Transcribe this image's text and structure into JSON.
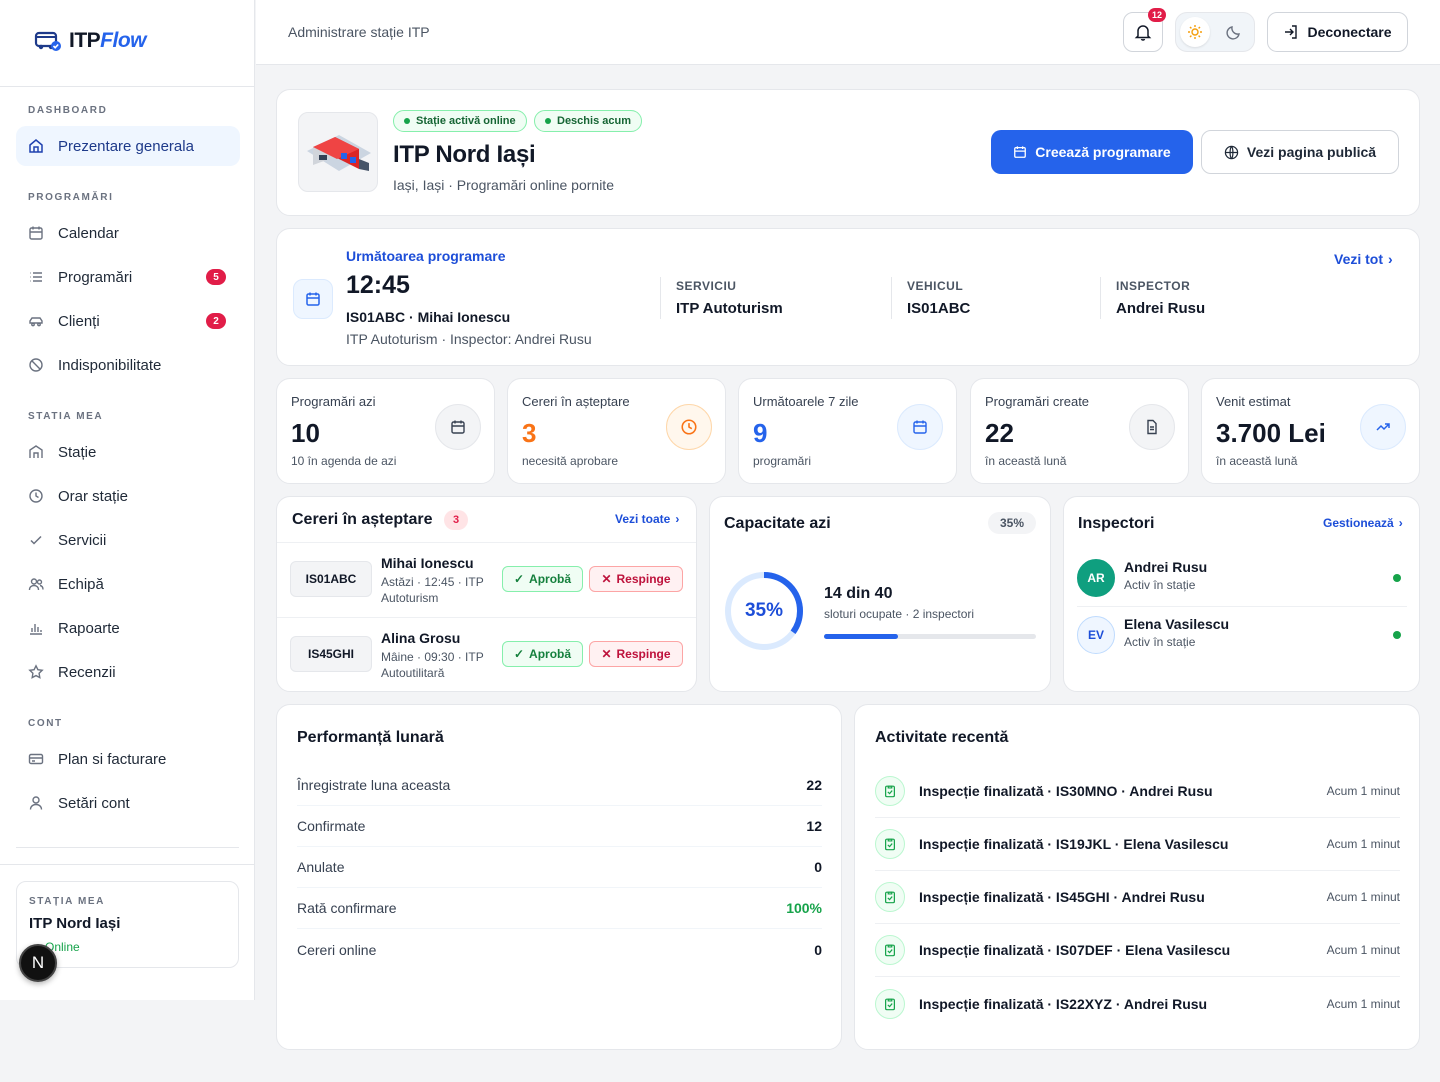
{
  "brand": {
    "name_part1": "ITP",
    "name_part2": "Flow"
  },
  "sidebar": {
    "sections": {
      "dashboard": "DASHBOARD",
      "programari": "PROGRAMĂRI",
      "statia": "STATIA MEA",
      "cont": "CONT"
    },
    "items": {
      "overview": "Prezentare generala",
      "calendar": "Calendar",
      "programari": "Programări",
      "programari_badge": "5",
      "clienti": "Clienți",
      "clienti_badge": "2",
      "indisponibilitate": "Indisponibilitate",
      "statie": "Stație",
      "orar": "Orar stație",
      "servicii": "Servicii",
      "echipa": "Echipă",
      "rapoarte": "Rapoarte",
      "recenzii": "Recenzii",
      "plan": "Plan si facturare",
      "setari": "Setări cont"
    },
    "my_station": {
      "label": "STAȚIA MEA",
      "name": "ITP Nord Iași",
      "status": "Online"
    },
    "avatar_letter": "N"
  },
  "header": {
    "title": "Administrare stație ITP",
    "notif_count": "12",
    "logout": "Deconectare"
  },
  "station": {
    "pill_online": "Stație activă online",
    "pill_open": "Deschis acum",
    "name": "ITP Nord Iași",
    "subtitle": "Iași, Iași · Programări online pornite",
    "create_btn": "Creează programare",
    "public_btn": "Vezi pagina publică"
  },
  "next": {
    "label": "Următoarea programare",
    "time": "12:45",
    "who": "IS01ABC · Mihai Ionescu",
    "details": "ITP Autoturism · Inspector: Andrei Rusu",
    "see_all": "Vezi tot",
    "service_label": "SERVICIU",
    "service": "ITP Autoturism",
    "vehicle_label": "VEHICUL",
    "vehicle": "IS01ABC",
    "inspector_label": "INSPECTOR",
    "inspector": "Andrei Rusu"
  },
  "stats": [
    {
      "title": "Programări azi",
      "value": "10",
      "sub": "10 în agenda de azi",
      "icon": "calendar-icon",
      "color": "#111827"
    },
    {
      "title": "Cereri în așteptare",
      "value": "3",
      "sub": "necesită aprobare",
      "icon": "clock-icon",
      "color": "#f97316"
    },
    {
      "title": "Următoarele 7 zile",
      "value": "9",
      "sub": "programări",
      "icon": "calendar-icon",
      "color": "#2563eb"
    },
    {
      "title": "Programări create",
      "value": "22",
      "sub": "în această lună",
      "icon": "document-icon",
      "color": "#111827"
    },
    {
      "title": "Venit estimat",
      "value": "3.700 Lei",
      "sub": "în această lună",
      "icon": "trending-up-icon",
      "color": "#111827"
    }
  ],
  "requests": {
    "title": "Cereri în așteptare",
    "count": "3",
    "see_all": "Vezi toate",
    "approve": "Aprobă",
    "reject": "Respinge",
    "items": [
      {
        "plate": "IS01ABC",
        "name": "Mihai Ionescu",
        "line1": "Astăzi · 12:45 · ITP",
        "line2": "Autoturism"
      },
      {
        "plate": "IS45GHI",
        "name": "Alina Grosu",
        "line1": "Mâine · 09:30 · ITP",
        "line2": "Autoutilitară"
      }
    ]
  },
  "capacity": {
    "title": "Capacitate azi",
    "percent_label": "35%",
    "percent": 0.35,
    "slots": "14 din 40",
    "sub": "sloturi ocupate · 2 inspectori"
  },
  "inspectors": {
    "title": "Inspectori",
    "manage": "Gestionează",
    "items": [
      {
        "initials": "AR",
        "name": "Andrei Rusu",
        "status": "Activ în stație"
      },
      {
        "initials": "EV",
        "name": "Elena Vasilescu",
        "status": "Activ în stație"
      }
    ]
  },
  "performance": {
    "title": "Performanță lunară",
    "rows": [
      {
        "label": "Înregistrate luna aceasta",
        "value": "22"
      },
      {
        "label": "Confirmate",
        "value": "12"
      },
      {
        "label": "Anulate",
        "value": "0"
      },
      {
        "label": "Rată confirmare",
        "value": "100%"
      },
      {
        "label": "Cereri online",
        "value": "0"
      }
    ]
  },
  "activity": {
    "title": "Activitate recentă",
    "items": [
      {
        "text": "Inspecție finalizată · IS30MNO · Andrei Rusu",
        "time": "Acum 1 minut"
      },
      {
        "text": "Inspecție finalizată · IS19JKL · Elena Vasilescu",
        "time": "Acum 1 minut"
      },
      {
        "text": "Inspecție finalizată · IS45GHI · Andrei Rusu",
        "time": "Acum 1 minut"
      },
      {
        "text": "Inspecție finalizată · IS07DEF · Elena Vasilescu",
        "time": "Acum 1 minut"
      },
      {
        "text": "Inspecție finalizată · IS22XYZ · Andrei Rusu",
        "time": "Acum 1 minut"
      }
    ]
  }
}
